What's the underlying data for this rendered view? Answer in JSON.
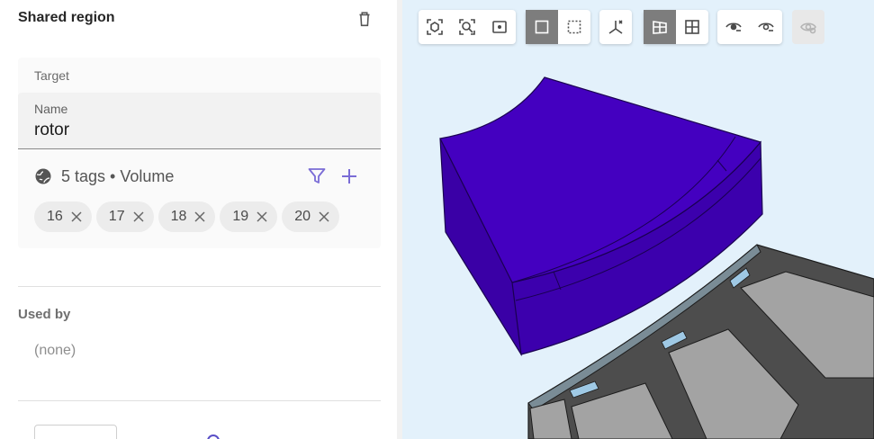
{
  "panel": {
    "title": "Shared region",
    "target": {
      "label": "Target",
      "name_label": "Name",
      "name_value": "rotor",
      "tags_summary": "5 tags • Volume",
      "tags": [
        "16",
        "17",
        "18",
        "19",
        "20"
      ]
    },
    "used_by": {
      "title": "Used by",
      "empty_text": "(none)"
    }
  },
  "viewport": {
    "toolbar_groups": [
      {
        "name": "camera",
        "buttons": [
          "zoom-fit-icon",
          "zoom-to-selection-icon",
          "frame-icon"
        ]
      },
      {
        "name": "selection-mode",
        "buttons": [
          "box-select-icon",
          "lasso-select-icon"
        ],
        "active": "box-select-icon"
      },
      {
        "name": "axes",
        "buttons": [
          "axes-icon"
        ]
      },
      {
        "name": "render-mode",
        "buttons": [
          "shaded-icon",
          "wireframe-icon"
        ],
        "active": "shaded-icon"
      },
      {
        "name": "visibility",
        "buttons": [
          "hide-icon",
          "show-icon"
        ]
      },
      {
        "name": "reset-visibility",
        "buttons": [
          "show-all-icon"
        ],
        "disabled": true
      }
    ],
    "colors": {
      "background": "#e3f1fb",
      "rotor_top": "#4400c0",
      "rotor_side": "#3c00ad",
      "stator": "#4d4d4d",
      "magnet": "#a3a3a3",
      "gap_blue": "#9fc9e5"
    }
  }
}
